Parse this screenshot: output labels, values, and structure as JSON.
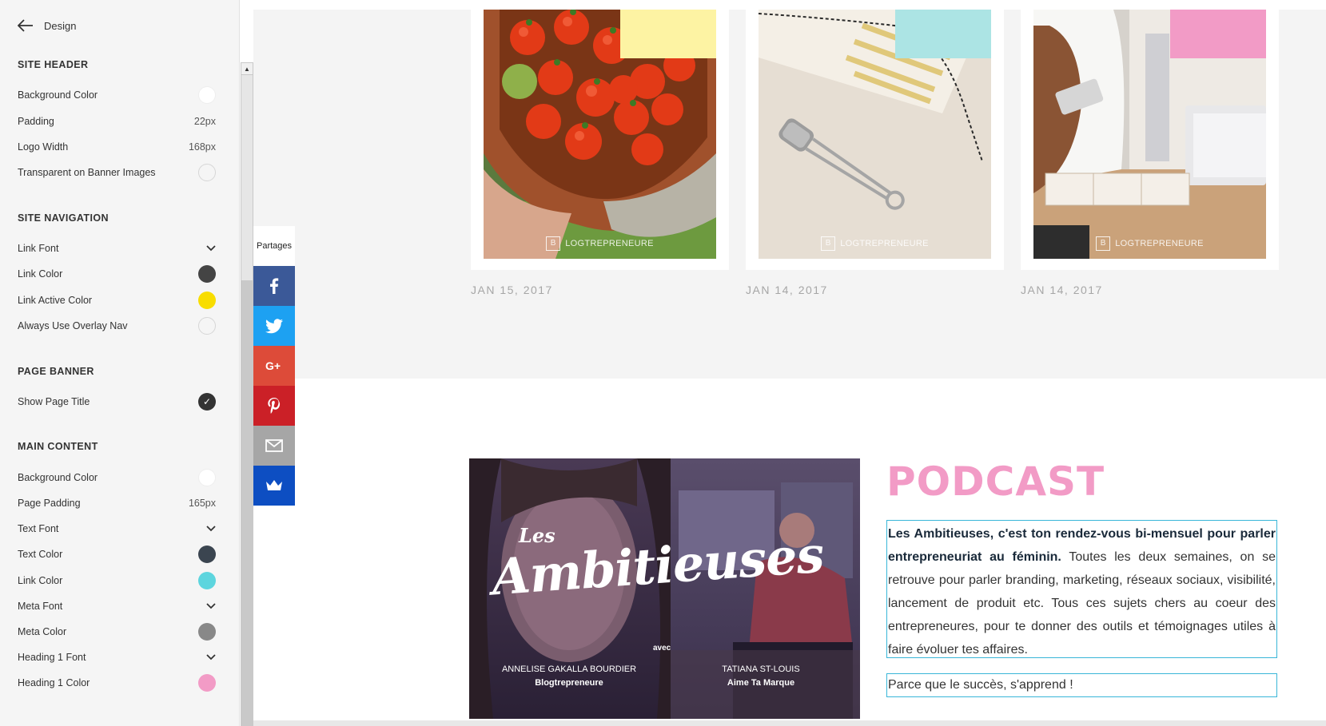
{
  "sidebar": {
    "back_label": "Design",
    "sections": [
      {
        "title": "SITE HEADER",
        "rows": [
          {
            "label": "Background Color",
            "kind": "swatch",
            "color": "#ffffff"
          },
          {
            "label": "Padding",
            "kind": "value",
            "value": "22px"
          },
          {
            "label": "Logo Width",
            "kind": "value",
            "value": "168px"
          },
          {
            "label": "Transparent on Banner Images",
            "kind": "toggle",
            "checked": false
          }
        ]
      },
      {
        "title": "SITE NAVIGATION",
        "rows": [
          {
            "label": "Link Font",
            "kind": "dropdown"
          },
          {
            "label": "Link Color",
            "kind": "swatch",
            "color": "#444444"
          },
          {
            "label": "Link Active Color",
            "kind": "swatch",
            "color": "#f8dd00"
          },
          {
            "label": "Always Use Overlay Nav",
            "kind": "toggle",
            "checked": false
          }
        ]
      },
      {
        "title": "PAGE BANNER",
        "rows": [
          {
            "label": "Show Page Title",
            "kind": "toggle",
            "checked": true
          }
        ]
      },
      {
        "title": "MAIN CONTENT",
        "rows": [
          {
            "label": "Background Color",
            "kind": "swatch",
            "color": "#ffffff"
          },
          {
            "label": "Page Padding",
            "kind": "value",
            "value": "165px"
          },
          {
            "label": "Text Font",
            "kind": "dropdown"
          },
          {
            "label": "Text Color",
            "kind": "swatch",
            "color": "#3b4550"
          },
          {
            "label": "Link Color",
            "kind": "swatch",
            "color": "#5dd5de"
          },
          {
            "label": "Meta Font",
            "kind": "dropdown"
          },
          {
            "label": "Meta Color",
            "kind": "swatch",
            "color": "#888888"
          },
          {
            "label": "Heading 1 Font",
            "kind": "dropdown"
          },
          {
            "label": "Heading 1 Color",
            "kind": "swatch",
            "color": "#f29bc6"
          }
        ]
      }
    ]
  },
  "blog": {
    "cards": [
      {
        "date": "JAN 15, 2017",
        "tab_color": "#fdf3a3",
        "watermark": "LOGTREPRENEURE"
      },
      {
        "date": "JAN 14, 2017",
        "tab_color": "#ace4e4",
        "watermark": "LOGTREPRENEURE"
      },
      {
        "date": "JAN 14, 2017",
        "tab_color": "#f29bc6",
        "watermark": "LOGTREPRENEURE"
      }
    ]
  },
  "share": {
    "label": "Partages",
    "buttons": [
      {
        "name": "facebook",
        "color": "#3b5998"
      },
      {
        "name": "twitter",
        "color": "#1da1f2"
      },
      {
        "name": "google-plus",
        "color": "#dd4b39"
      },
      {
        "name": "pinterest",
        "color": "#cb2027"
      },
      {
        "name": "email",
        "color": "#a6a6a6"
      },
      {
        "name": "crown",
        "color": "#0d4ec2"
      }
    ]
  },
  "podcast": {
    "image": {
      "title_small": "Les",
      "title_big": "Ambitieuses",
      "avec": "avec",
      "host1_name": "ANNELISE GAKALLA BOURDIER",
      "host1_brand": "Blogtrepreneure",
      "host2_name": "TATIANA ST-LOUIS",
      "host2_brand": "Aime Ta Marque"
    },
    "title": "PODCAST",
    "desc_bold": "Les Ambitieuses, c'est ton rendez-vous bi-mensuel pour parler entrepreneuriat au féminin.",
    "desc_rest": " Toutes les deux semaines, on se retrouve pour parler branding, marketing, réseaux sociaux, visibilité, lancement de produit etc. Tous ces sujets chers au coeur des entrepreneures, pour te donner des outils et témoignages utiles à faire évoluer tes affaires.",
    "quote": "Parce que le succès, s'apprend !"
  }
}
